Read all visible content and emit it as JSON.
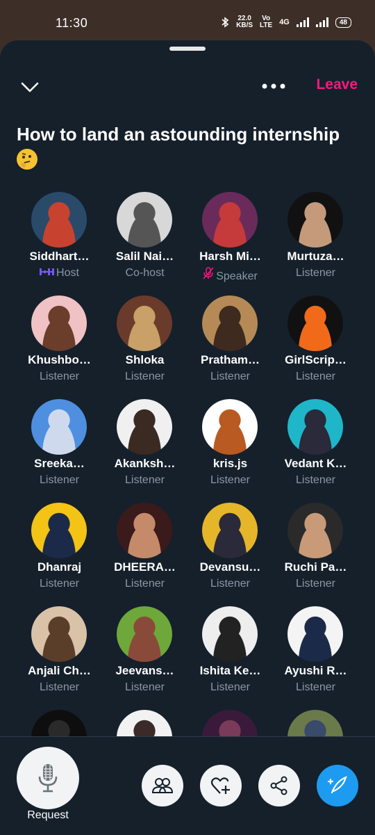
{
  "status": {
    "time": "11:30",
    "speed_value": "22.0",
    "speed_unit": "KB/S",
    "volte": "Vo",
    "volte2": "LTE",
    "network": "4G",
    "battery": "48"
  },
  "header": {
    "leave_label": "Leave"
  },
  "space": {
    "title": "How to land an astounding internship"
  },
  "participants": [
    {
      "name": "Siddhart…",
      "role": "Host",
      "colors": [
        "#2a4a6a",
        "#c7432f"
      ]
    },
    {
      "name": "Salil Nai…",
      "role": "Co-host",
      "colors": [
        "#d8d8d8",
        "#555555"
      ]
    },
    {
      "name": "Harsh Mi…",
      "role": "Speaker",
      "colors": [
        "#6a2b5b",
        "#c53a3a"
      ]
    },
    {
      "name": "Murtuza…",
      "role": "Listener",
      "colors": [
        "#111111",
        "#c49a7a"
      ]
    },
    {
      "name": "Khushbo…",
      "role": "Listener",
      "colors": [
        "#f0c2c5",
        "#6b3d2b"
      ]
    },
    {
      "name": "Shloka",
      "role": "Listener",
      "colors": [
        "#6a3b2a",
        "#c8a068"
      ]
    },
    {
      "name": "Pratham…",
      "role": "Listener",
      "colors": [
        "#b58a56",
        "#3e2a1e"
      ]
    },
    {
      "name": "GirlScrip…",
      "role": "Listener",
      "colors": [
        "#111111",
        "#f06a1a"
      ]
    },
    {
      "name": "Sreeka…",
      "role": "Listener",
      "colors": [
        "#4e8fe0",
        "#cfd9ee"
      ]
    },
    {
      "name": "Akanksh…",
      "role": "Listener",
      "colors": [
        "#f0f0f0",
        "#3a2a22"
      ]
    },
    {
      "name": "kris.js",
      "role": "Listener",
      "colors": [
        "#ffffff",
        "#b85a22"
      ]
    },
    {
      "name": "Vedant K…",
      "role": "Listener",
      "colors": [
        "#1fb6c9",
        "#2a2a3a"
      ]
    },
    {
      "name": "Dhanraj",
      "role": "Listener",
      "colors": [
        "#f3c316",
        "#1c2a4a"
      ]
    },
    {
      "name": "DHEERA…",
      "role": "Listener",
      "colors": [
        "#3a1a1a",
        "#c58a6a"
      ]
    },
    {
      "name": "Devansu…",
      "role": "Listener",
      "colors": [
        "#e5b62a",
        "#2a2a3a"
      ]
    },
    {
      "name": "Ruchi Pa…",
      "role": "Listener",
      "colors": [
        "#2a2a2a",
        "#c89a78"
      ]
    },
    {
      "name": "Anjali Ch…",
      "role": "Listener",
      "colors": [
        "#d9c2a8",
        "#5a3e2a"
      ]
    },
    {
      "name": "Jeevans…",
      "role": "Listener",
      "colors": [
        "#6fa83a",
        "#8a4a3a"
      ]
    },
    {
      "name": "Ishita Ke…",
      "role": "Listener",
      "colors": [
        "#eeeeee",
        "#222222"
      ]
    },
    {
      "name": "Ayushi R…",
      "role": "Listener",
      "colors": [
        "#f4f4f4",
        "#1c2a4a"
      ]
    },
    {
      "name": "",
      "role": "",
      "colors": [
        "#0e0e0e",
        "#2a2a2a"
      ]
    },
    {
      "name": "",
      "role": "",
      "colors": [
        "#f2f2f2",
        "#3a2a2a"
      ]
    },
    {
      "name": "",
      "role": "",
      "colors": [
        "#3a1a3a",
        "#7a3a5a"
      ]
    },
    {
      "name": "",
      "role": "",
      "colors": [
        "#6a7a4a",
        "#3a4a6a"
      ]
    }
  ],
  "bottom": {
    "request_label": "Request"
  },
  "icons": {
    "collapse": "chevron-down-icon",
    "more": "more-icon",
    "microphone": "microphone-icon",
    "people": "people-icon",
    "heart_plus": "heart-plus-icon",
    "share": "share-icon",
    "compose": "compose-icon"
  },
  "accent": {
    "leave": "#f91880",
    "compose": "#1d9bf0",
    "host_badge": "#7856ff",
    "muted": "#f91880"
  }
}
